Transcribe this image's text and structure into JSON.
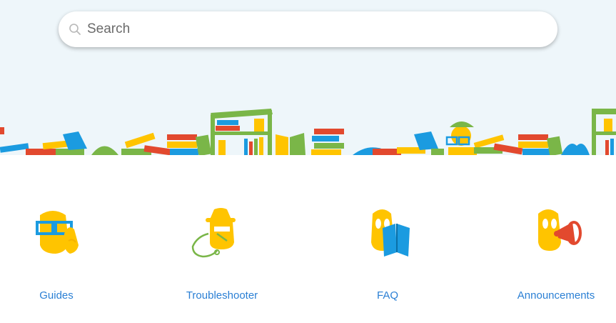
{
  "search": {
    "placeholder": "Search"
  },
  "categories": [
    {
      "label": "Guides",
      "icon": "mascot-glasses-icon"
    },
    {
      "label": "Troubleshooter",
      "icon": "mascot-detective-icon"
    },
    {
      "label": "FAQ",
      "icon": "mascot-book-icon"
    },
    {
      "label": "Announcements",
      "icon": "mascot-megaphone-icon"
    }
  ],
  "colors": {
    "hero_background": "#eef6fa",
    "link": "#2a7fd4",
    "mascot_yellow": "#ffc400",
    "book_blue": "#1b9be0",
    "book_green": "#7ab648",
    "book_red": "#e2492e"
  }
}
